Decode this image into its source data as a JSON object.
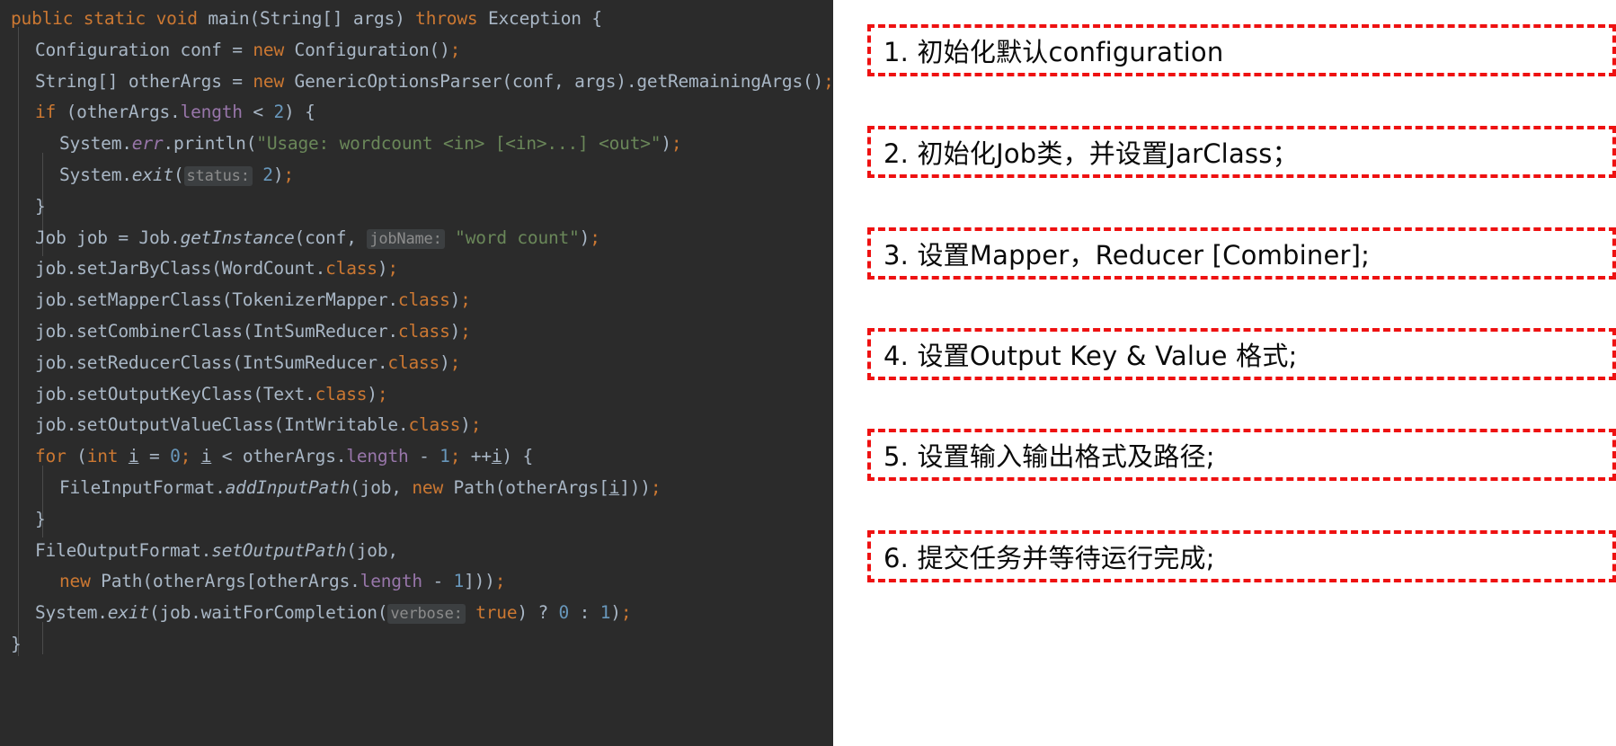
{
  "editor": {
    "background_color": "#2b2b2b",
    "code_lines": [
      {
        "id": "line-1",
        "indent": 0,
        "tokens": [
          {
            "t": "public",
            "c": "kw"
          },
          {
            "t": " ",
            "c": "punc"
          },
          {
            "t": "static",
            "c": "kw"
          },
          {
            "t": " ",
            "c": "punc"
          },
          {
            "t": "void",
            "c": "kw"
          },
          {
            "t": " ",
            "c": "punc"
          },
          {
            "t": "main",
            "c": "id"
          },
          {
            "t": "(",
            "c": "punc"
          },
          {
            "t": "String",
            "c": "typ"
          },
          {
            "t": "[] ",
            "c": "punc"
          },
          {
            "t": "args",
            "c": "id"
          },
          {
            "t": ") ",
            "c": "punc"
          },
          {
            "t": "throws",
            "c": "kw"
          },
          {
            "t": " ",
            "c": "punc"
          },
          {
            "t": "Exception",
            "c": "typ"
          },
          {
            "t": " {",
            "c": "punc"
          }
        ]
      },
      {
        "id": "line-2",
        "indent": 1,
        "tokens": [
          {
            "t": "Configuration conf ",
            "c": "id"
          },
          {
            "t": "= ",
            "c": "punc"
          },
          {
            "t": "new",
            "c": "kw"
          },
          {
            "t": " Configuration()",
            "c": "id"
          },
          {
            "t": ";",
            "c": "semi"
          }
        ]
      },
      {
        "id": "line-3",
        "indent": 1,
        "tokens": [
          {
            "t": "String",
            "c": "typ"
          },
          {
            "t": "[] otherArgs ",
            "c": "id"
          },
          {
            "t": "= ",
            "c": "punc"
          },
          {
            "t": "new",
            "c": "kw"
          },
          {
            "t": " GenericOptionsParser(conf, args).getRemainingArgs()",
            "c": "id"
          },
          {
            "t": ";",
            "c": "semi"
          }
        ]
      },
      {
        "id": "line-4",
        "indent": 1,
        "tokens": [
          {
            "t": "if",
            "c": "kw"
          },
          {
            "t": " (otherArgs.",
            "c": "punc"
          },
          {
            "t": "length",
            "c": "fld"
          },
          {
            "t": " < ",
            "c": "punc"
          },
          {
            "t": "2",
            "c": "num"
          },
          {
            "t": ") {",
            "c": "punc"
          }
        ]
      },
      {
        "id": "line-5",
        "indent": 2,
        "tokens": [
          {
            "t": "System.",
            "c": "id"
          },
          {
            "t": "err",
            "c": "stat"
          },
          {
            "t": ".println(",
            "c": "id"
          },
          {
            "t": "\"Usage: wordcount <in> [<in>...] <out>\"",
            "c": "str"
          },
          {
            "t": ")",
            "c": "punc"
          },
          {
            "t": ";",
            "c": "semi"
          }
        ]
      },
      {
        "id": "line-6",
        "indent": 2,
        "tokens": [
          {
            "t": "System.",
            "c": "id"
          },
          {
            "t": "exit",
            "c": "mth"
          },
          {
            "t": "(",
            "c": "punc"
          },
          {
            "t": "status:",
            "c": "hint"
          },
          {
            "t": " ",
            "c": "punc"
          },
          {
            "t": "2",
            "c": "num"
          },
          {
            "t": ")",
            "c": "punc"
          },
          {
            "t": ";",
            "c": "semi"
          }
        ]
      },
      {
        "id": "line-7",
        "indent": 1,
        "tokens": [
          {
            "t": "}",
            "c": "punc"
          }
        ]
      },
      {
        "id": "line-8",
        "indent": 1,
        "tokens": [
          {
            "t": "Job job ",
            "c": "id"
          },
          {
            "t": "= ",
            "c": "punc"
          },
          {
            "t": "Job.",
            "c": "id"
          },
          {
            "t": "getInstance",
            "c": "mth"
          },
          {
            "t": "(conf, ",
            "c": "punc"
          },
          {
            "t": "jobName:",
            "c": "hint"
          },
          {
            "t": " ",
            "c": "punc"
          },
          {
            "t": "\"word count\"",
            "c": "str"
          },
          {
            "t": ")",
            "c": "punc"
          },
          {
            "t": ";",
            "c": "semi"
          }
        ]
      },
      {
        "id": "line-9",
        "indent": 1,
        "tokens": [
          {
            "t": "job.setJarByClass(WordCount.",
            "c": "id"
          },
          {
            "t": "class",
            "c": "kw"
          },
          {
            "t": ")",
            "c": "punc"
          },
          {
            "t": ";",
            "c": "semi"
          }
        ]
      },
      {
        "id": "line-10",
        "indent": 1,
        "tokens": [
          {
            "t": "job.setMapperClass(TokenizerMapper.",
            "c": "id"
          },
          {
            "t": "class",
            "c": "kw"
          },
          {
            "t": ")",
            "c": "punc"
          },
          {
            "t": ";",
            "c": "semi"
          }
        ]
      },
      {
        "id": "line-11",
        "indent": 1,
        "tokens": [
          {
            "t": "job.setCombinerClass(IntSumReducer.",
            "c": "id"
          },
          {
            "t": "class",
            "c": "kw"
          },
          {
            "t": ")",
            "c": "punc"
          },
          {
            "t": ";",
            "c": "semi"
          }
        ]
      },
      {
        "id": "line-12",
        "indent": 1,
        "tokens": [
          {
            "t": "job.setReducerClass(IntSumReducer.",
            "c": "id"
          },
          {
            "t": "class",
            "c": "kw"
          },
          {
            "t": ")",
            "c": "punc"
          },
          {
            "t": ";",
            "c": "semi"
          }
        ]
      },
      {
        "id": "line-13",
        "indent": 1,
        "tokens": [
          {
            "t": "job.setOutputKeyClass(Text.",
            "c": "id"
          },
          {
            "t": "class",
            "c": "kw"
          },
          {
            "t": ")",
            "c": "punc"
          },
          {
            "t": ";",
            "c": "semi"
          }
        ]
      },
      {
        "id": "line-14",
        "indent": 1,
        "tokens": [
          {
            "t": "job.setOutputValueClass(IntWritable.",
            "c": "id"
          },
          {
            "t": "class",
            "c": "kw"
          },
          {
            "t": ")",
            "c": "punc"
          },
          {
            "t": ";",
            "c": "semi"
          }
        ]
      },
      {
        "id": "line-15",
        "indent": 1,
        "tokens": [
          {
            "t": "for",
            "c": "kw"
          },
          {
            "t": " (",
            "c": "punc"
          },
          {
            "t": "int",
            "c": "kw"
          },
          {
            "t": " ",
            "c": "punc"
          },
          {
            "t": "i",
            "c": "var-u"
          },
          {
            "t": " = ",
            "c": "punc"
          },
          {
            "t": "0",
            "c": "num"
          },
          {
            "t": ";",
            "c": "semi"
          },
          {
            "t": " ",
            "c": "punc"
          },
          {
            "t": "i",
            "c": "var-u"
          },
          {
            "t": " < otherArgs.",
            "c": "punc"
          },
          {
            "t": "length",
            "c": "fld"
          },
          {
            "t": " - ",
            "c": "punc"
          },
          {
            "t": "1",
            "c": "num"
          },
          {
            "t": ";",
            "c": "semi"
          },
          {
            "t": " ++",
            "c": "punc"
          },
          {
            "t": "i",
            "c": "var-u"
          },
          {
            "t": ") {",
            "c": "punc"
          }
        ]
      },
      {
        "id": "line-16",
        "indent": 2,
        "tokens": [
          {
            "t": "FileInputFormat.",
            "c": "id"
          },
          {
            "t": "addInputPath",
            "c": "mth"
          },
          {
            "t": "(job, ",
            "c": "punc"
          },
          {
            "t": "new",
            "c": "kw"
          },
          {
            "t": " Path(otherArgs[",
            "c": "id"
          },
          {
            "t": "i",
            "c": "var-u"
          },
          {
            "t": "]))",
            "c": "punc"
          },
          {
            "t": ";",
            "c": "semi"
          }
        ]
      },
      {
        "id": "line-17",
        "indent": 1,
        "tokens": [
          {
            "t": "}",
            "c": "punc"
          }
        ]
      },
      {
        "id": "line-18",
        "indent": 1,
        "tokens": [
          {
            "t": "FileOutputFormat.",
            "c": "id"
          },
          {
            "t": "setOutputPath",
            "c": "mth"
          },
          {
            "t": "(job,",
            "c": "punc"
          }
        ]
      },
      {
        "id": "line-19",
        "indent": 2,
        "tokens": [
          {
            "t": "new",
            "c": "kw"
          },
          {
            "t": " Path(otherArgs[otherArgs.",
            "c": "id"
          },
          {
            "t": "length",
            "c": "fld"
          },
          {
            "t": " - ",
            "c": "punc"
          },
          {
            "t": "1",
            "c": "num"
          },
          {
            "t": "]))",
            "c": "punc"
          },
          {
            "t": ";",
            "c": "semi"
          }
        ]
      },
      {
        "id": "line-20",
        "indent": 1,
        "tokens": [
          {
            "t": "System.",
            "c": "id"
          },
          {
            "t": "exit",
            "c": "mth"
          },
          {
            "t": "(job.waitForCompletion(",
            "c": "punc"
          },
          {
            "t": "verbose:",
            "c": "hint"
          },
          {
            "t": " ",
            "c": "punc"
          },
          {
            "t": "true",
            "c": "kw"
          },
          {
            "t": ") ? ",
            "c": "punc"
          },
          {
            "t": "0",
            "c": "num"
          },
          {
            "t": " : ",
            "c": "punc"
          },
          {
            "t": "1",
            "c": "num"
          },
          {
            "t": ")",
            "c": "punc"
          },
          {
            "t": ";",
            "c": "semi"
          }
        ]
      },
      {
        "id": "line-21",
        "indent": 0,
        "tokens": [
          {
            "t": "}",
            "c": "punc"
          }
        ]
      }
    ]
  },
  "annotations": {
    "border_color": "#ee1111",
    "text_color": "#0a0a0a",
    "items": [
      {
        "id": "note-1",
        "label": "1. 初始化默认configuration"
      },
      {
        "id": "note-2",
        "label": "2. 初始化Job类，并设置JarClass；"
      },
      {
        "id": "note-3",
        "label": "3. 设置Mapper，Reducer [Combiner];"
      },
      {
        "id": "note-4",
        "label": "4. 设置Output Key & Value 格式;"
      },
      {
        "id": "note-5",
        "label": "5. 设置输入输出格式及路径;"
      },
      {
        "id": "note-6",
        "label": "6. 提交任务并等待运行完成;"
      }
    ]
  }
}
